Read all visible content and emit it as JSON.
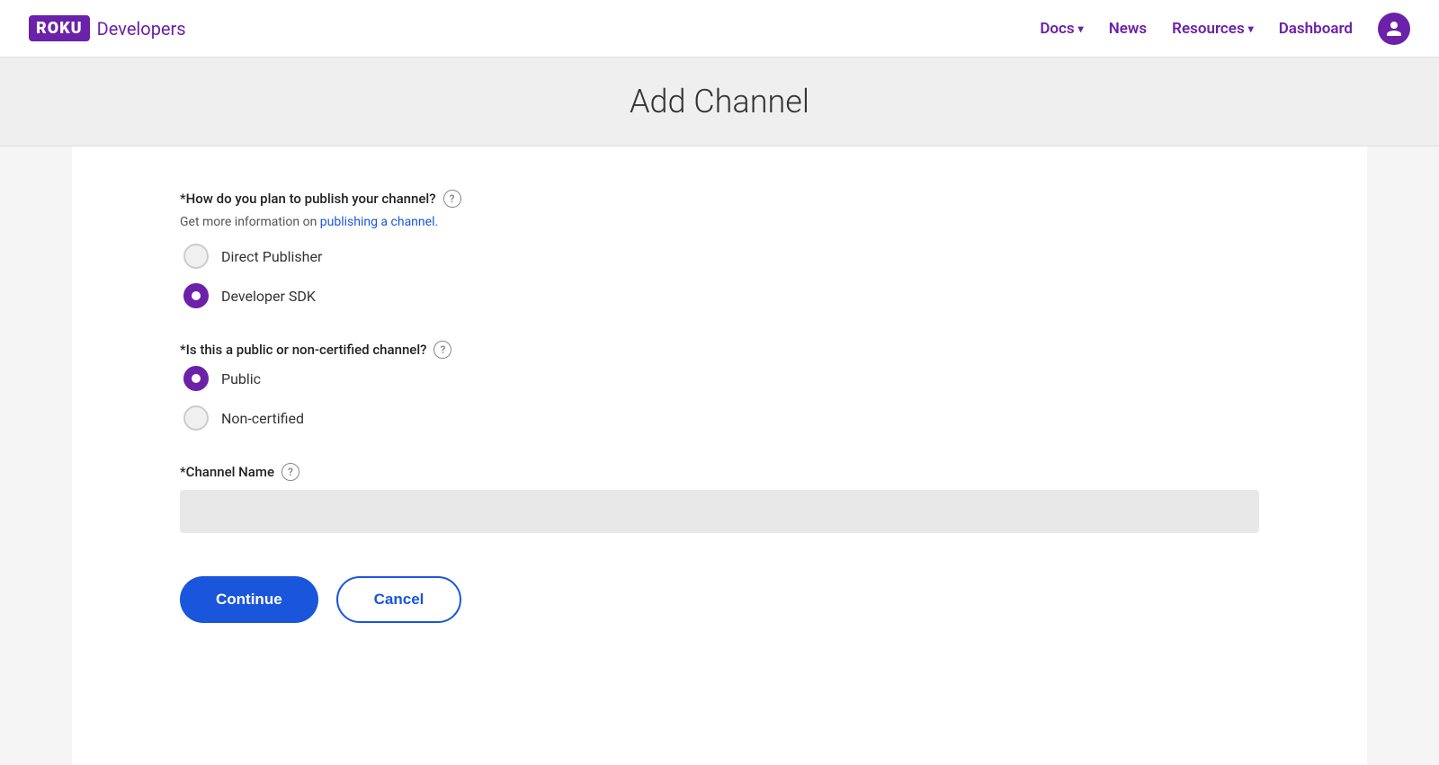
{
  "navbar": {
    "logo_text": "ROKU",
    "developers_label": "Developers",
    "docs_label": "Docs",
    "news_label": "News",
    "resources_label": "Resources",
    "dashboard_label": "Dashboard",
    "avatar_icon": "person"
  },
  "page": {
    "title": "Add Channel"
  },
  "form": {
    "publish_question": "*How do you plan to publish your channel?",
    "publish_help": "?",
    "publish_info": "Get more information on ",
    "publish_link": "publishing a channel.",
    "option_direct_publisher": "Direct Publisher",
    "option_developer_sdk": "Developer SDK",
    "channel_type_question": "*Is this a public or non-certified channel?",
    "channel_type_help": "?",
    "option_public": "Public",
    "option_non_certified": "Non-certified",
    "channel_name_label": "*Channel Name",
    "channel_name_help": "?",
    "channel_name_placeholder": "",
    "continue_label": "Continue",
    "cancel_label": "Cancel"
  }
}
